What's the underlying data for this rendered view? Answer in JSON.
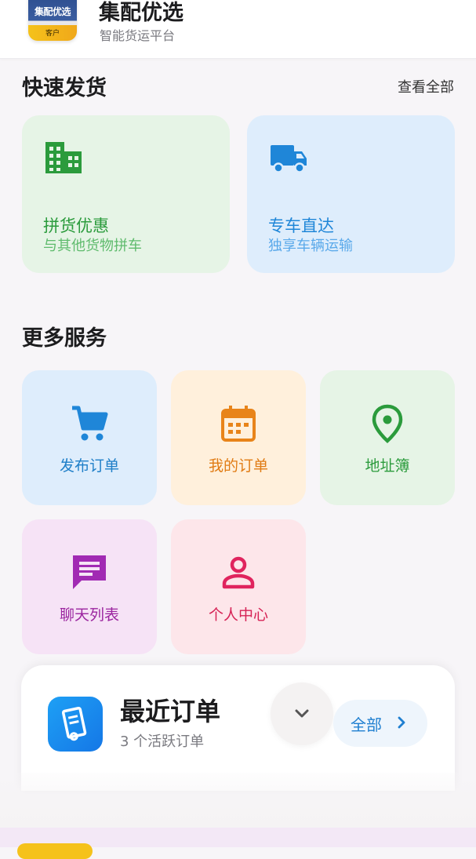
{
  "header": {
    "logo_text": "集配优选",
    "logo_badge": "客户",
    "title": "集配优选",
    "subtitle": "智能货运平台"
  },
  "quick_ship": {
    "title": "快速发货",
    "view_all": "查看全部",
    "cards": [
      {
        "title": "拼货优惠",
        "desc": "与其他货物拼车",
        "icon": "building-icon",
        "color": "#2b9b3c"
      },
      {
        "title": "专车直达",
        "desc": "独享车辆运输",
        "icon": "truck-icon",
        "color": "#1f86d8"
      }
    ]
  },
  "more_services": {
    "title": "更多服务",
    "items": [
      {
        "label": "发布订单",
        "icon": "cart-icon",
        "color": "#1f86d8",
        "bg": "#deedfc"
      },
      {
        "label": "我的订单",
        "icon": "calendar-icon",
        "color": "#e8841a",
        "bg": "#fff0dc"
      },
      {
        "label": "地址簿",
        "icon": "location-pin-icon",
        "color": "#2b9b3c",
        "bg": "#e6f4e6"
      },
      {
        "label": "聊天列表",
        "icon": "chat-icon",
        "color": "#a12ab3",
        "bg": "#f6e3f6"
      },
      {
        "label": "个人中心",
        "icon": "person-icon",
        "color": "#e0245e",
        "bg": "#fde6ea"
      }
    ]
  },
  "recent_orders": {
    "title": "最近订单",
    "subtitle": "3 个活跃订单",
    "all_label": "全部",
    "icon": "document-icon"
  }
}
